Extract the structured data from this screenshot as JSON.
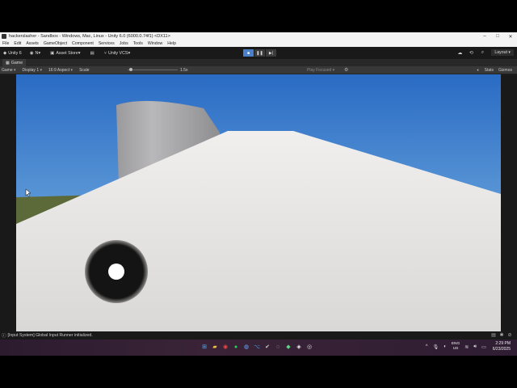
{
  "window": {
    "title": "hackerslasher - Sandbox - Windows, Mac, Linux - Unity 6.0 (6000.0.74f1) <DX11>",
    "controls": [
      "–",
      "□",
      "✕"
    ]
  },
  "menu": [
    "File",
    "Edit",
    "Assets",
    "GameObject",
    "Component",
    "Services",
    "Jobs",
    "Tools",
    "Window",
    "Help"
  ],
  "toolbar": {
    "account": "Unity 6",
    "user_initial": "N",
    "asset_store": "Asset Store",
    "vcs": "Unity VCS",
    "layout": "Layout"
  },
  "tab": {
    "label": "Game"
  },
  "gamebar": {
    "mode": "Game",
    "display": "Display 1",
    "aspect": "16:9 Aspect",
    "scale_label": "Scale",
    "scale_value": "1.5x",
    "play_focused": "Play Focused",
    "stats": "Stats",
    "gizmos": "Gizmos"
  },
  "status": {
    "message": "[Input System] Global Input Runner initialized."
  },
  "taskbar": {
    "lang_line1": "ENG",
    "lang_line2": "US",
    "time": "2:29 PM",
    "date": "6/23/2025"
  },
  "colors": {
    "sky_top": "#2d6fc6",
    "sky_bottom": "#9cc4e6",
    "ground": "#5d6a3c",
    "floor": "#e6e4e2",
    "joystick": "#141414"
  }
}
